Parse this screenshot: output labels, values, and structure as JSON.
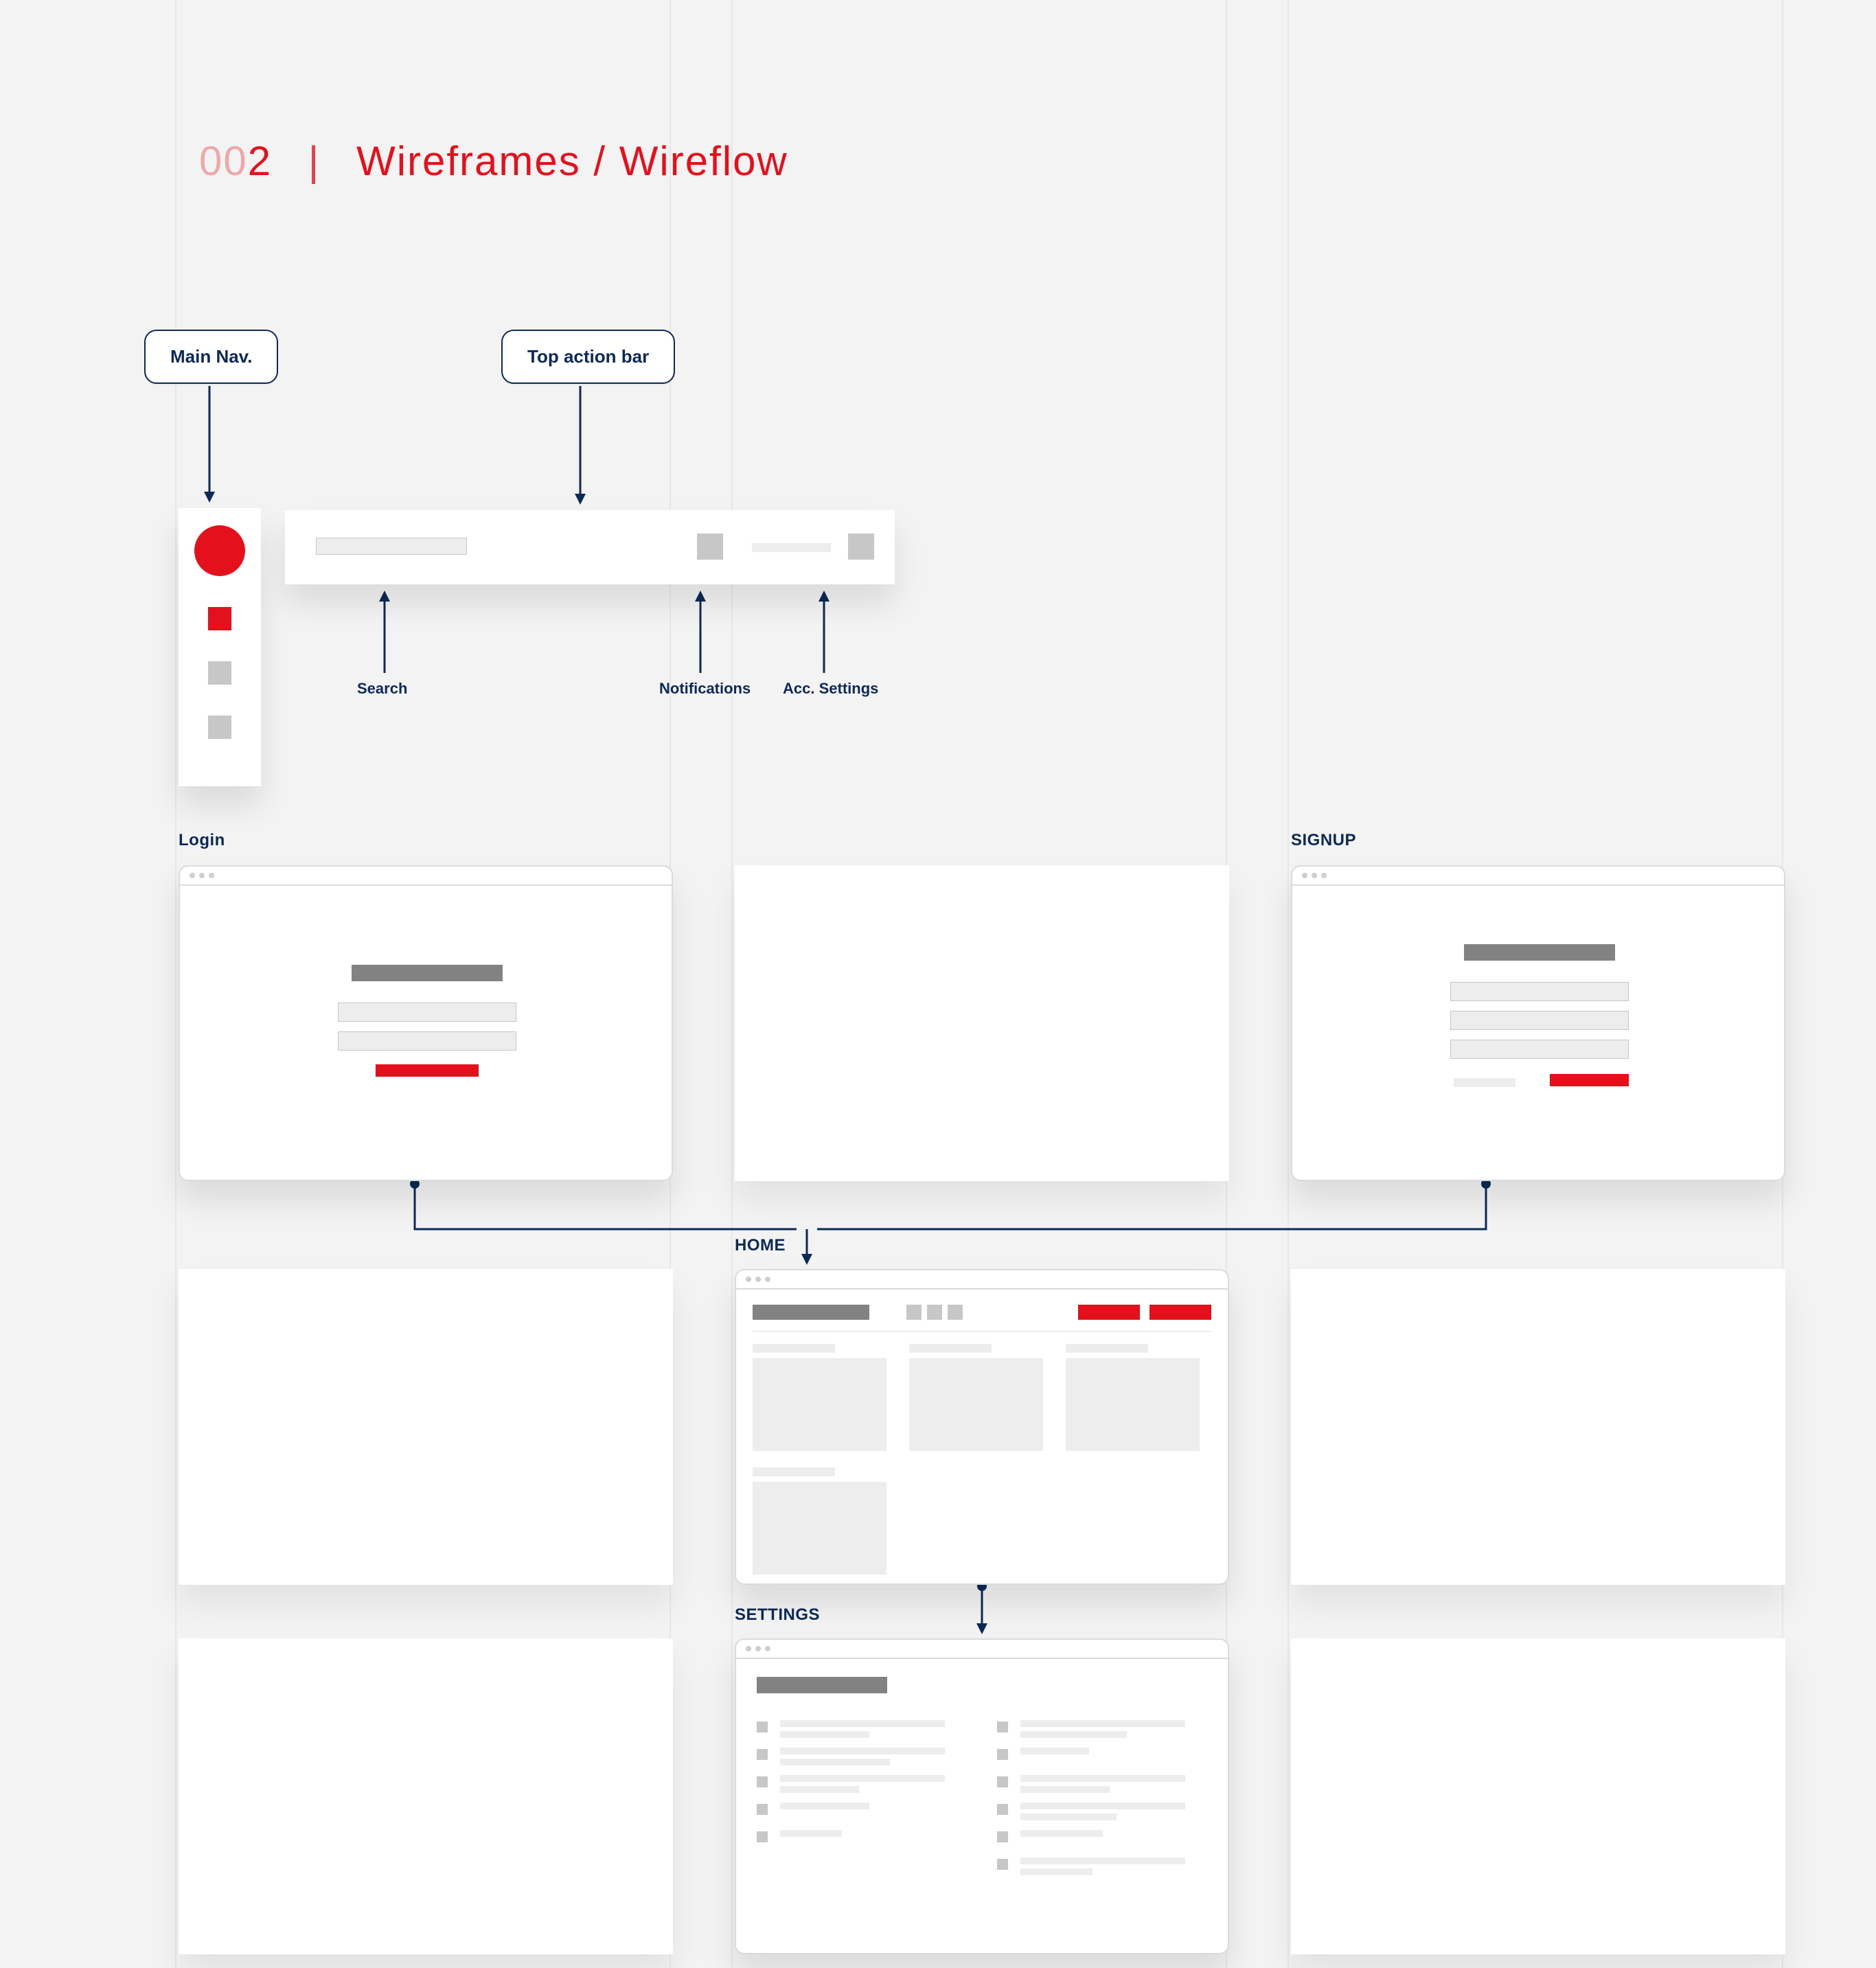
{
  "page": {
    "number_prefix": "00",
    "number": "2",
    "separator": "|",
    "title": "Wireframes / Wireflow"
  },
  "callouts": {
    "main_nav": "Main Nav.",
    "top_action_bar": "Top action bar"
  },
  "sublabels": {
    "search": "Search",
    "notifications": "Notifications",
    "account": "Acc. Settings"
  },
  "sections": {
    "login": "Login",
    "signup": "SIGNUP",
    "home": "HOME",
    "settings": "SETTINGS"
  },
  "colors": {
    "accent": "#e4101c",
    "navy": "#0c2a55"
  }
}
